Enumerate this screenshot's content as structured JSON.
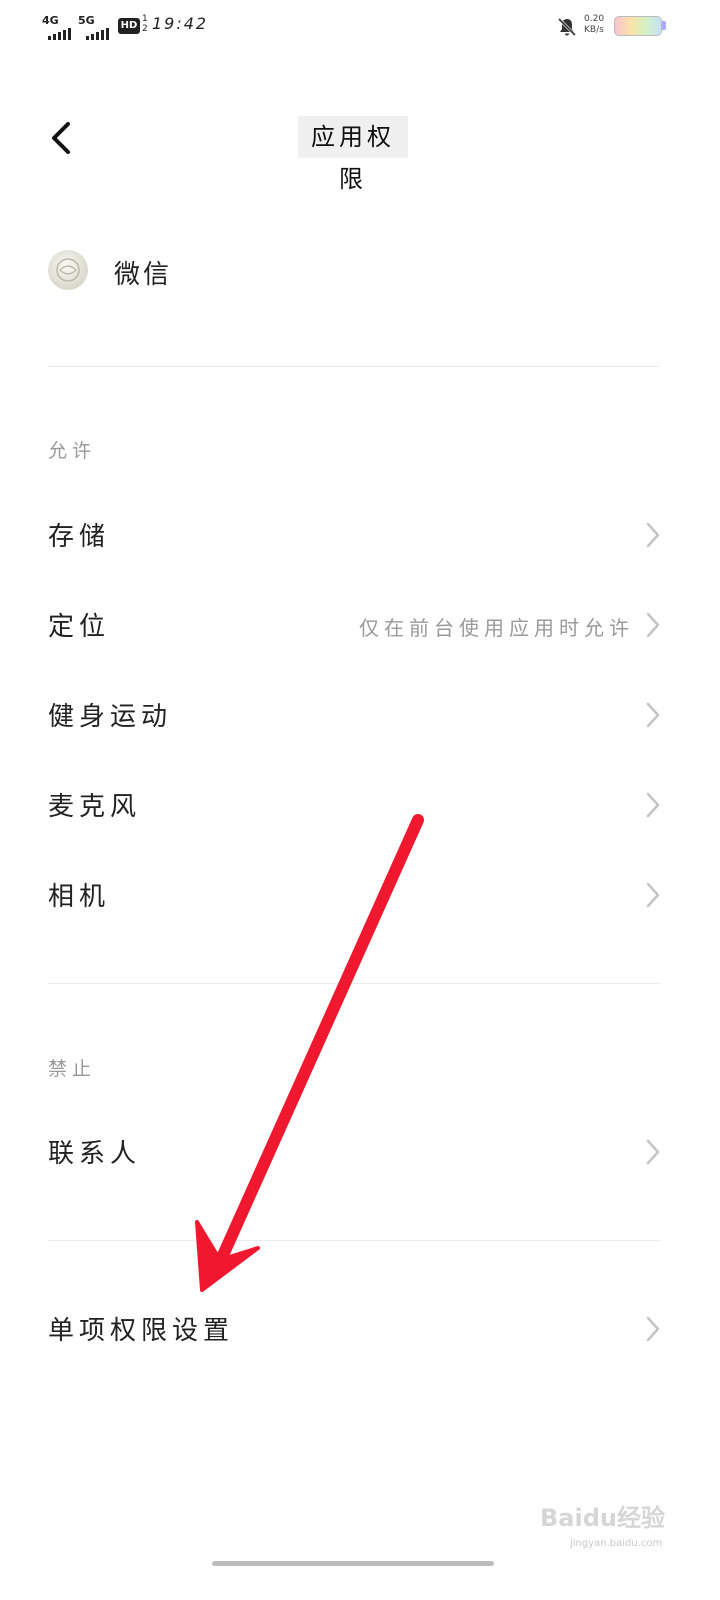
{
  "status_bar": {
    "net1": "4G",
    "net2": "5G",
    "hd": "HD",
    "sim_top": "1",
    "sim_bottom": "2",
    "time": "19:42",
    "speed_value": "0.20",
    "speed_unit": "KB/s",
    "icons": [
      "signal-icon",
      "signal-icon",
      "hd-icon",
      "bell-off-icon",
      "battery-icon"
    ]
  },
  "header": {
    "back_icon": "chevron-left-icon",
    "title": "应用权限"
  },
  "app": {
    "name": "微信",
    "icon": "app-icon"
  },
  "sections": {
    "allowed_label": "允许",
    "denied_label": "禁止"
  },
  "allowed_items": [
    {
      "label": "存储",
      "status": ""
    },
    {
      "label": "定位",
      "status": "仅在前台使用应用时允许"
    },
    {
      "label": "健身运动",
      "status": ""
    },
    {
      "label": "麦克风",
      "status": ""
    },
    {
      "label": "相机",
      "status": ""
    }
  ],
  "denied_items": [
    {
      "label": "联系人",
      "status": ""
    }
  ],
  "single_settings": {
    "label": "单项权限设置"
  },
  "overlay": {
    "arrow_color": "#f0182e"
  },
  "watermark": {
    "text": "Baidu经验",
    "sub": "jingyan.baidu.com"
  },
  "colors": {
    "text": "#222222",
    "secondary": "#999999",
    "divider": "#ebebeb"
  }
}
